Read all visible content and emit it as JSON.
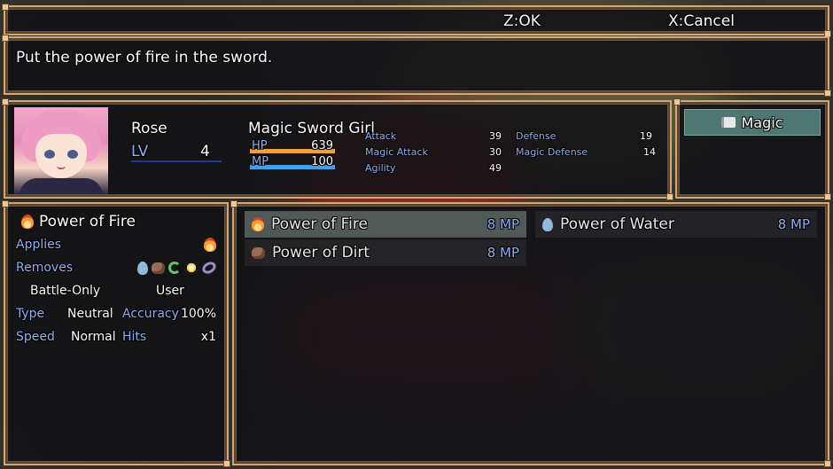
{
  "keys": {
    "ok": "Z:OK",
    "cancel": "X:Cancel"
  },
  "help": {
    "text": "Put the power of fire in the sword."
  },
  "actor": {
    "name": "Rose",
    "level_label": "LV",
    "level": "4",
    "class": "Magic Sword Girl",
    "hp_label": "HP",
    "hp": "639",
    "hp_rate": 1.0,
    "mp_label": "MP",
    "mp": "100",
    "mp_rate": 1.0,
    "params": [
      {
        "name": "Attack",
        "value": "39"
      },
      {
        "name": "Magic Attack",
        "value": "30"
      },
      {
        "name": "Agility",
        "value": "49"
      },
      {
        "name": "Defense",
        "value": "19"
      },
      {
        "name": "Magic Defense",
        "value": "14"
      }
    ],
    "face_icon": "pink-haired-girl-portrait"
  },
  "command": {
    "label": "Magic",
    "icon": "book-icon"
  },
  "detail": {
    "title": "Power of Fire",
    "applies_label": "Applies",
    "removes_label": "Removes",
    "occasion": "Battle-Only",
    "scope": "User",
    "type_label": "Type",
    "type_value": "Neutral",
    "accuracy_label": "Accuracy",
    "accuracy_value": "100%",
    "speed_label": "Speed",
    "speed_value": "Normal",
    "hits_label": "Hits",
    "hits_value": "x1"
  },
  "skills": [
    {
      "name": "Power of Fire",
      "cost": "8 MP",
      "icon": "fire-icon"
    },
    {
      "name": "Power of Water",
      "cost": "8 MP",
      "icon": "water-icon"
    },
    {
      "name": "Power of Dirt",
      "cost": "8 MP",
      "icon": "dirt-icon"
    }
  ],
  "colors": {
    "window_border": "#d2a878",
    "system_blue": "#8fb0f0",
    "hp_gauge": "#f0a040",
    "mp_gauge": "#40a0e8",
    "command_selected": "#4f7772"
  }
}
